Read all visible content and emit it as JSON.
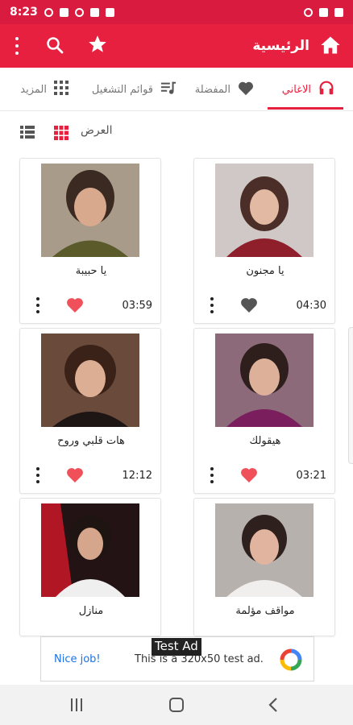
{
  "status_bar": {
    "time": "8:23"
  },
  "app_bar": {
    "title": "الرئيسية"
  },
  "tabs": [
    {
      "label": "الاغاني",
      "icon": "headphones-icon",
      "active": true
    },
    {
      "label": "المفضلة",
      "icon": "heart-icon",
      "active": false
    },
    {
      "label": "قوائم التشغيل",
      "icon": "playlist-icon",
      "active": false
    },
    {
      "label": "المزيد",
      "icon": "grid-icon",
      "active": false
    }
  ],
  "view_bar": {
    "label": "العرض"
  },
  "songs": [
    {
      "title": "يا مجنون",
      "duration": "04:30",
      "favorite": false
    },
    {
      "title": "يا حبيبة",
      "duration": "03:59",
      "favorite": true
    },
    {
      "title": "هيقولك",
      "duration": "03:21",
      "favorite": true
    },
    {
      "title": "هات قلبي وروح",
      "duration": "12:12",
      "favorite": true
    },
    {
      "title": "مواقف مؤلمة",
      "duration": "",
      "favorite": false
    },
    {
      "title": "منازل",
      "duration": "",
      "favorite": false
    }
  ],
  "ad": {
    "badge": "Test Ad",
    "cta": "Nice job!",
    "text": "This is a 320x50 test ad."
  },
  "colors": {
    "primary": "#e8203f",
    "status": "#d81b3f",
    "heart_on": "#f0505a",
    "heart_off": "#555555"
  }
}
